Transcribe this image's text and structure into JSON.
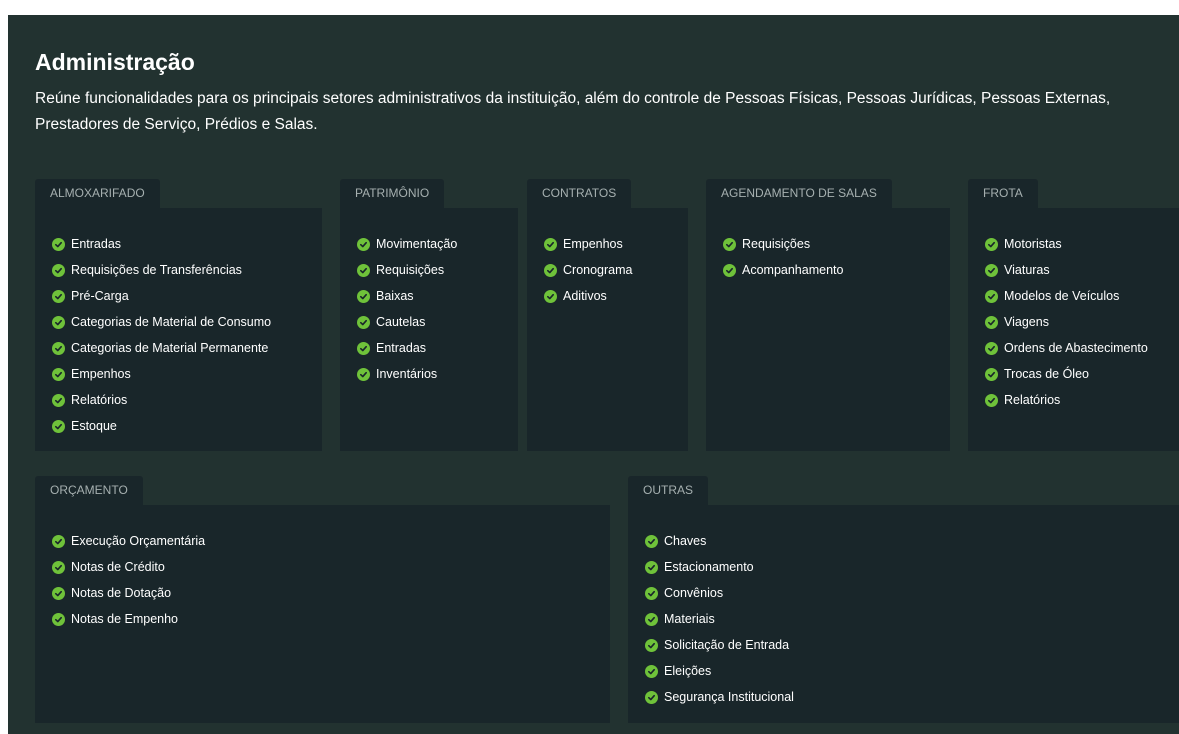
{
  "page": {
    "title": "Administração",
    "description": "Reúne funcionalidades para os principais setores administrativos da instituição, além do controle de Pessoas Físicas, Pessoas Jurídicas, Pessoas Externas, Prestadores de Serviço, Prédios e Salas."
  },
  "colors": {
    "background": "#223230",
    "card": "#19262a",
    "tab_text": "#a6b0b0",
    "check": "#6fc23a"
  },
  "icons": {
    "item": "check-circle-icon"
  },
  "sections": {
    "almoxarifado": {
      "title": "ALMOXARIFADO",
      "items": [
        "Entradas",
        "Requisições de Transferências",
        "Pré-Carga",
        "Categorias de Material de Consumo",
        "Categorias de Material Permanente",
        "Empenhos",
        "Relatórios",
        "Estoque"
      ]
    },
    "patrimonio": {
      "title": "PATRIMÔNIO",
      "items": [
        "Movimentação",
        "Requisições",
        "Baixas",
        "Cautelas",
        "Entradas",
        "Inventários"
      ]
    },
    "contratos": {
      "title": "CONTRATOS",
      "items": [
        "Empenhos",
        "Cronograma",
        "Aditivos"
      ]
    },
    "agendamento": {
      "title": "AGENDAMENTO DE SALAS",
      "items": [
        "Requisições",
        "Acompanhamento"
      ]
    },
    "frota": {
      "title": "FROTA",
      "items": [
        "Motoristas",
        "Viaturas",
        "Modelos de Veículos",
        "Viagens",
        "Ordens de Abastecimento",
        "Trocas de Óleo",
        "Relatórios"
      ]
    },
    "orcamento": {
      "title": "ORÇAMENTO",
      "items": [
        "Execução Orçamentária",
        "Notas de Crédito",
        "Notas de Dotação",
        "Notas de Empenho"
      ]
    },
    "outras": {
      "title": "OUTRAS",
      "items": [
        "Chaves",
        "Estacionamento",
        "Convênios",
        "Materiais",
        "Solicitação de Entrada",
        "Eleições",
        "Segurança Institucional"
      ]
    }
  }
}
